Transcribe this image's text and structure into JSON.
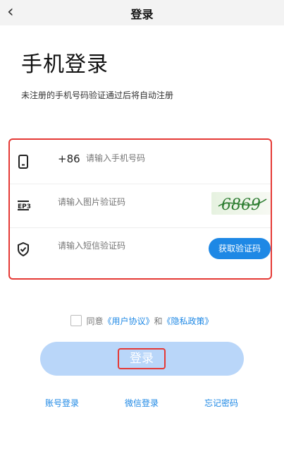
{
  "nav": {
    "back_icon": "chevron-left-icon",
    "title": "登录"
  },
  "header": {
    "title": "手机登录",
    "subtitle": "未注册的手机号码验证通过后将自动注册"
  },
  "form": {
    "phone": {
      "icon": "phone-icon",
      "prefix": "+86",
      "placeholder": "请输入手机号码"
    },
    "image_captcha": {
      "icon": "image-code-icon",
      "placeholder": "请输入图片验证码",
      "captcha_text": "6869"
    },
    "sms": {
      "icon": "shield-icon",
      "placeholder": "请输入短信验证码",
      "button_label": "获取验证码"
    }
  },
  "agreement": {
    "agree_text": "同意",
    "terms_link": "《用户协议》",
    "and_text": "和",
    "privacy_link": "《隐私政策》"
  },
  "actions": {
    "login_label": "登录"
  },
  "bottom_links": {
    "account_login": "账号登录",
    "wechat_login": "微信登录",
    "forgot_password": "忘记密码"
  },
  "colors": {
    "accent": "#1e88e5",
    "login_button": "#b9d6f9",
    "highlight_border": "#e53935"
  }
}
